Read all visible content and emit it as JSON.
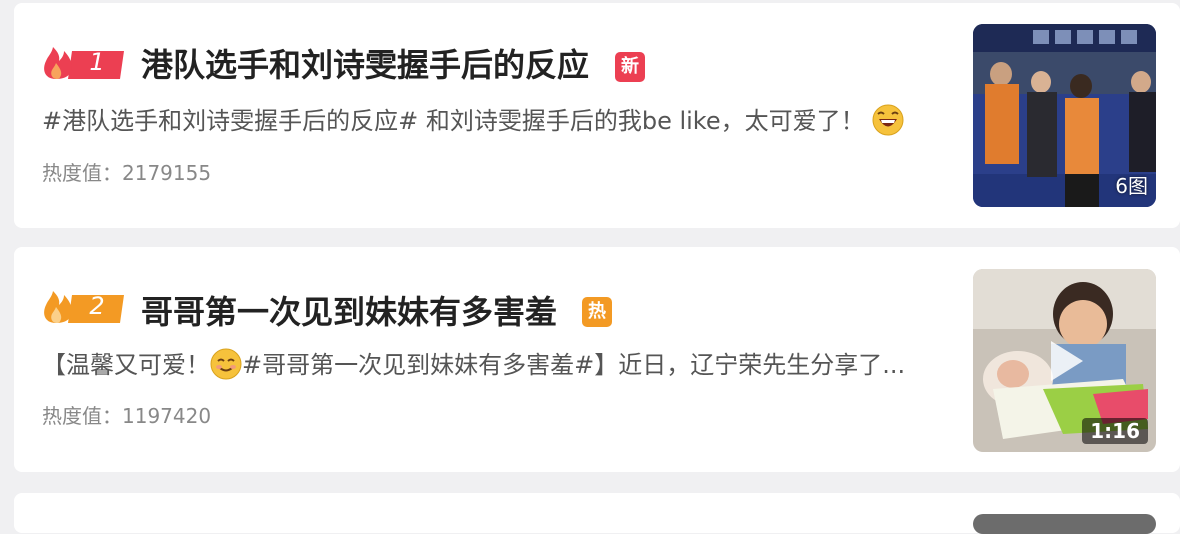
{
  "items": [
    {
      "rank": "1",
      "title": "港队选手和刘诗雯握手后的反应",
      "badge": "新",
      "summary": "#港队选手和刘诗雯握手后的反应# 和刘诗雯握手后的我be like，太可爱了！",
      "heat_label": "热度值：",
      "heat_value": "2179155",
      "thumb_label": "6图",
      "thumb_icon": "photo-thumbnail"
    },
    {
      "rank": "2",
      "title": "哥哥第一次见到妹妹有多害羞",
      "badge": "热",
      "summary_prefix": "【温馨又可爱！",
      "summary_suffix": "#哥哥第一次见到妹妹有多害羞#】近日，辽宁荣先生分享了...",
      "heat_label": "热度值：",
      "heat_value": "1197420",
      "thumb_duration": "1:16",
      "thumb_icon": "video-thumbnail"
    }
  ],
  "colors": {
    "flame_1": "#ec3f52",
    "flame_2": "#f39a24",
    "badge_new": "#ec3f52",
    "badge_hot": "#f39a24"
  }
}
